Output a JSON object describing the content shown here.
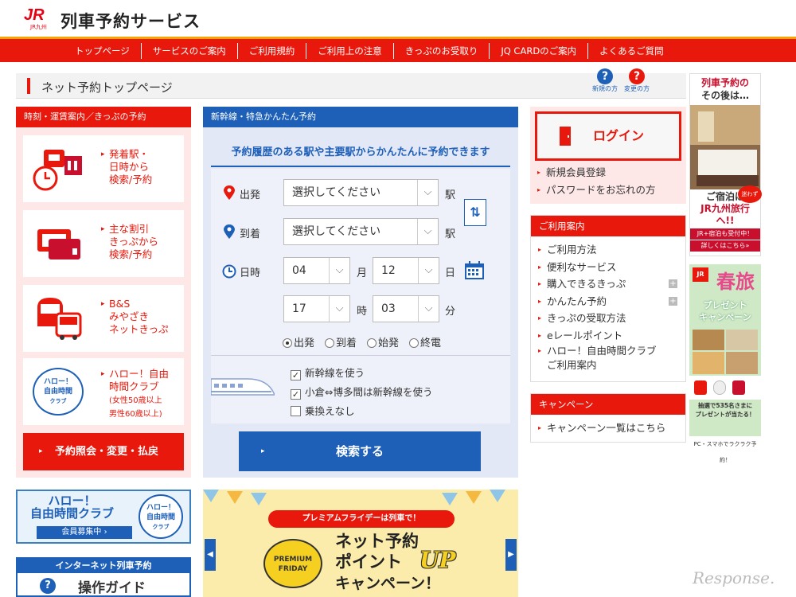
{
  "header": {
    "site_title": "列車予約サービス",
    "logo_text": "JR",
    "logo_sub": "JR九州"
  },
  "nav": [
    "トップページ",
    "サービスのご案内",
    "ご利用規約",
    "ご利用上の注意",
    "きっぷのお受取り",
    "JQ CARDのご案内",
    "よくあるご質問"
  ],
  "page": {
    "title": "ネット予約トップページ",
    "help_new": "新規の方",
    "help_change": "変更の方"
  },
  "left": {
    "header": "時刻・運賃案内／きっぷの予約",
    "cards": [
      {
        "lines": [
          "発着駅・",
          "日時から",
          "検索/予約"
        ]
      },
      {
        "lines": [
          "主な割引",
          "きっぷから",
          "検索/予約"
        ]
      },
      {
        "lines": [
          "B&S",
          "みやざき",
          "ネットきっぷ"
        ]
      },
      {
        "lines": [
          "ハロー！自由",
          "時間クラブ"
        ],
        "small": [
          "(女性50歳以上",
          "男性60歳以上)"
        ],
        "badge": [
          "ハロー！",
          "自由時間",
          "クラブ"
        ]
      }
    ],
    "button": "予約照会・変更・払戻"
  },
  "middle": {
    "header": "新幹線・特急かんたん予約",
    "subtitle": "予約履歴のある駅や主要駅からかんたんに予約できます",
    "depart_label": "出発",
    "arrive_label": "到着",
    "datetime_label": "日時",
    "depart_value": "選択してください",
    "arrive_value": "選択してください",
    "station_unit": "駅",
    "month": "04",
    "month_unit": "月",
    "day": "12",
    "day_unit": "日",
    "hour": "17",
    "hour_unit": "時",
    "minute": "03",
    "minute_unit": "分",
    "radios": [
      "出発",
      "到着",
      "始発",
      "終電"
    ],
    "radio_selected": "出発",
    "checks": [
      {
        "label": "新幹線を使う",
        "checked": true
      },
      {
        "label": "小倉⇔博多間は新幹線を使う",
        "checked": true
      },
      {
        "label": "乗換えなし",
        "checked": false
      }
    ],
    "search_button": "検索する"
  },
  "right": {
    "login": "ログイン",
    "account_links": [
      "新規会員登録",
      "パスワードをお忘れの方"
    ],
    "guide_header": "ご利用案内",
    "guide_links": [
      "ご利用方法",
      "便利なサービス",
      "購入できるきっぷ",
      "かんたん予約",
      "きっぷの受取方法",
      "eレールポイント",
      "ハロー！自由時間クラブ",
      "ご利用案内"
    ],
    "campaign_header": "キャンペーン",
    "campaign_link": "キャンペーン一覧はこちら"
  },
  "ads": {
    "ad1_top": [
      "列車予約の",
      "その後は…"
    ],
    "ad1_bottom": [
      "ご宿泊は",
      "JR九州旅行",
      "へ!!"
    ],
    "ad1_badge": "迷わず",
    "ad1_note": "JR+宿泊も受付中！",
    "ad1_more": "詳しくはこちら»",
    "ad2_title": "春旅",
    "ad2_sub": [
      "プレゼント",
      "キャンペーン"
    ],
    "ad2_note": [
      "抽選で535名さまに",
      "プレゼントが当たる！"
    ],
    "ad2_foot": "PC・スマホでラクラク予約！"
  },
  "bottom": {
    "banner1": [
      "ハロー！",
      "自由時間クラブ"
    ],
    "banner1_sub": "会員募集中 ›",
    "banner1_badge": [
      "ハロー！",
      "自由時間",
      "クラブ"
    ],
    "banner2_head": "インターネット列車予約",
    "banner2_title": "操作ガイド",
    "carousel_ribbon": "プレミアムフライデーは列車で！",
    "carousel_badge": [
      "PREMIUM",
      "FRIDAY"
    ],
    "carousel_title": [
      "ネット予約",
      "ポイント",
      "キャンペーン！"
    ],
    "carousel_up": "UP"
  },
  "watermark": "Response.",
  "colors": {
    "jr_red": "#e8180c",
    "nav_accent": "#f5a600",
    "blue": "#1e60b8",
    "pink_bg": "#fde7e7",
    "blue_bg": "#e3e8f7"
  }
}
